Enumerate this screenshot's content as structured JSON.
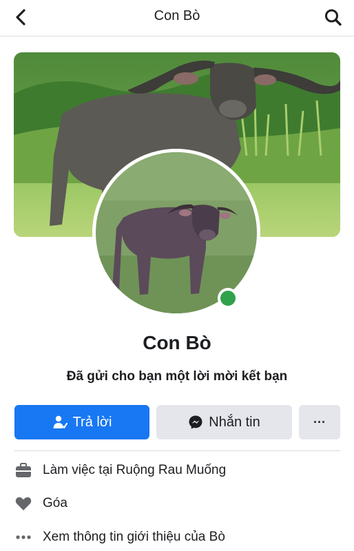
{
  "header": {
    "title": "Con Bò"
  },
  "profile": {
    "name": "Con Bò",
    "status_text": "Đã gửi cho bạn một lời mời kết bạn",
    "online": true
  },
  "actions": {
    "reply_label": "Trả lời",
    "message_label": "Nhắn tin",
    "more_label": "···"
  },
  "details": [
    {
      "icon": "briefcase-icon",
      "label": "Làm việc tại Ruộng Rau Muống"
    },
    {
      "icon": "heart-icon",
      "label": "Góa"
    },
    {
      "icon": "more-dots-icon",
      "label": "Xem thông tin giới thiệu của Bò"
    }
  ],
  "colors": {
    "primary": "#1877f2",
    "secondary_button": "#e4e6eb",
    "online": "#31a24c",
    "text": "#1c1e21"
  }
}
